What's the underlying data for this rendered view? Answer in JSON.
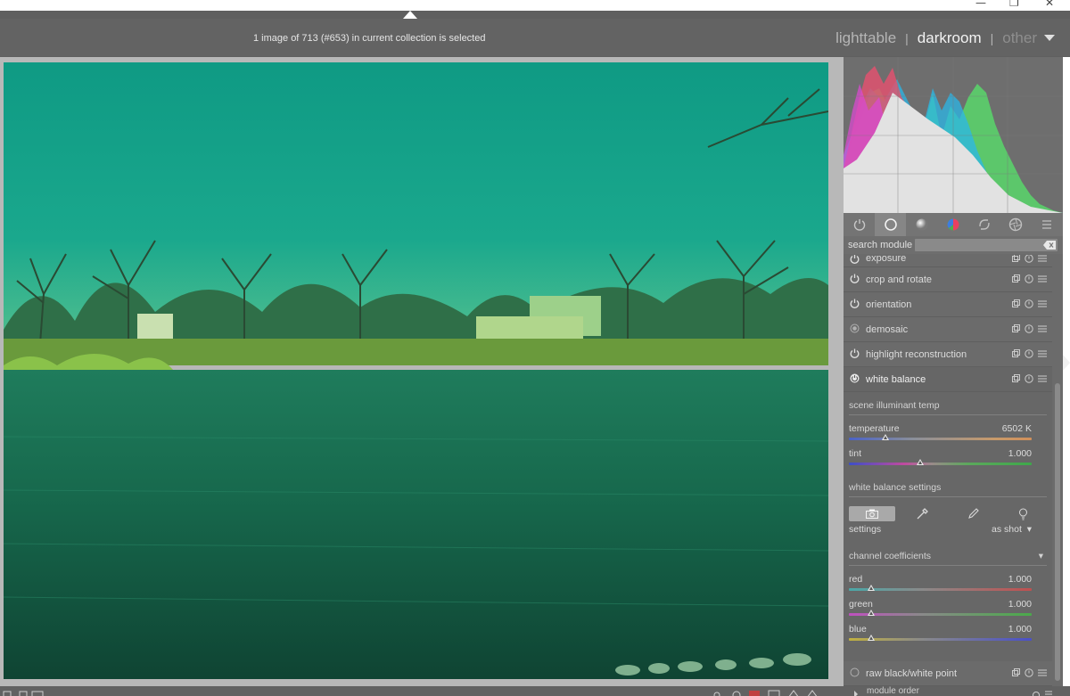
{
  "window": {
    "minimize_glyph": "—",
    "maximize_glyph": "❐",
    "close_glyph": "✕"
  },
  "header": {
    "collection_info": "1 image of 713 (#653) in current collection is selected",
    "views": [
      "lighttable",
      "darkroom",
      "other"
    ],
    "separator": "|",
    "active_view": "darkroom"
  },
  "module_tabs": [
    {
      "icon": "power-icon"
    },
    {
      "icon": "circle-icon",
      "active": true
    },
    {
      "icon": "gradient-sphere-icon"
    },
    {
      "icon": "color-wheel-icon"
    },
    {
      "icon": "correct-icon"
    },
    {
      "icon": "aperture-icon"
    },
    {
      "icon": "menu-icon"
    }
  ],
  "search": {
    "label": "search module",
    "placeholder": ""
  },
  "modules": {
    "exposure": "exposure",
    "crop": "crop and rotate",
    "orientation": "orientation",
    "demosaic": "demosaic",
    "highlight": "highlight reconstruction",
    "white_balance": "white balance",
    "raw": "raw black/white point"
  },
  "white_balance": {
    "section_illuminant": "scene illuminant temp",
    "temperature": {
      "label": "temperature",
      "value": "6502 K",
      "position": 0.2
    },
    "tint": {
      "label": "tint",
      "value": "1.000",
      "position": 0.39
    },
    "section_settings": "white balance settings",
    "settings_label": "settings",
    "settings_value": "as shot",
    "dropdown_arrow": "▾",
    "section_coefficients": "channel coefficients",
    "red": {
      "label": "red",
      "value": "1.000",
      "position": 0.12
    },
    "green": {
      "label": "green",
      "value": "1.000",
      "position": 0.12
    },
    "blue": {
      "label": "blue",
      "value": "1.000",
      "position": 0.12
    }
  },
  "footer": {
    "module_order": "module order"
  },
  "colors": {
    "accent_tint": "#1aa087",
    "panel": "#6b6b6b",
    "header": "#636363"
  }
}
